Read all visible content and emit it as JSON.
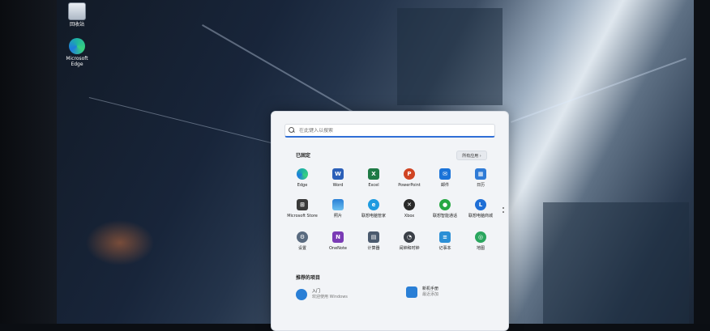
{
  "desktop": {
    "icons": [
      {
        "label": "回收站",
        "icon": "recycle-bin-icon"
      },
      {
        "label": "Microsoft Edge",
        "icon": "edge-icon"
      }
    ]
  },
  "start_menu": {
    "search_placeholder": "在此键入以搜索",
    "pinned_title": "已固定",
    "all_apps_label": "所有应用 ›",
    "pinned_apps": [
      {
        "label": "Edge",
        "icon": "edge-icon",
        "color": "#1f8fd0"
      },
      {
        "label": "Word",
        "icon": "word-icon",
        "color": "#2b5fb8"
      },
      {
        "label": "Excel",
        "icon": "excel-icon",
        "color": "#1e7a45"
      },
      {
        "label": "PowerPoint",
        "icon": "powerpoint-icon",
        "color": "#d04423"
      },
      {
        "label": "邮件",
        "icon": "mail-icon",
        "color": "#1a73d8"
      },
      {
        "label": "日历",
        "icon": "calendar-icon",
        "color": "#2f7bd6"
      },
      {
        "label": "Microsoft Store",
        "icon": "store-icon",
        "color": "#3a3a3a"
      },
      {
        "label": "照片",
        "icon": "photos-icon",
        "color": "#2a7fd6"
      },
      {
        "label": "联想电脑管家",
        "icon": "lenovo-manager-icon",
        "color": "#1e9be0"
      },
      {
        "label": "Xbox",
        "icon": "xbox-icon",
        "color": "#2a2a2a"
      },
      {
        "label": "联想智能通话",
        "icon": "lenovo-call-icon",
        "color": "#27a844"
      },
      {
        "label": "联想电脑商城",
        "icon": "lenovo-store-icon",
        "color": "#1f6fd6"
      },
      {
        "label": "设置",
        "icon": "settings-icon",
        "color": "#5a6b80"
      },
      {
        "label": "OneNote",
        "icon": "onenote-icon",
        "color": "#7a3bb5"
      },
      {
        "label": "计算器",
        "icon": "calculator-icon",
        "color": "#4b5a6e"
      },
      {
        "label": "闹钟和时钟",
        "icon": "clock-icon",
        "color": "#3a3f47"
      },
      {
        "label": "记事本",
        "icon": "notepad-icon",
        "color": "#2b8fd6"
      },
      {
        "label": "地图",
        "icon": "maps-icon",
        "color": "#2aa65e"
      }
    ],
    "recommended_title": "推荐的项目",
    "recommended": [
      {
        "title": "入门",
        "subtitle": "欢迎使用 Windows",
        "icon": "get-started-icon",
        "color": "#2a7fd6"
      },
      {
        "title": "新机手册",
        "subtitle": "最近添加",
        "icon": "manual-icon",
        "color": "#2a7fd6"
      }
    ]
  }
}
